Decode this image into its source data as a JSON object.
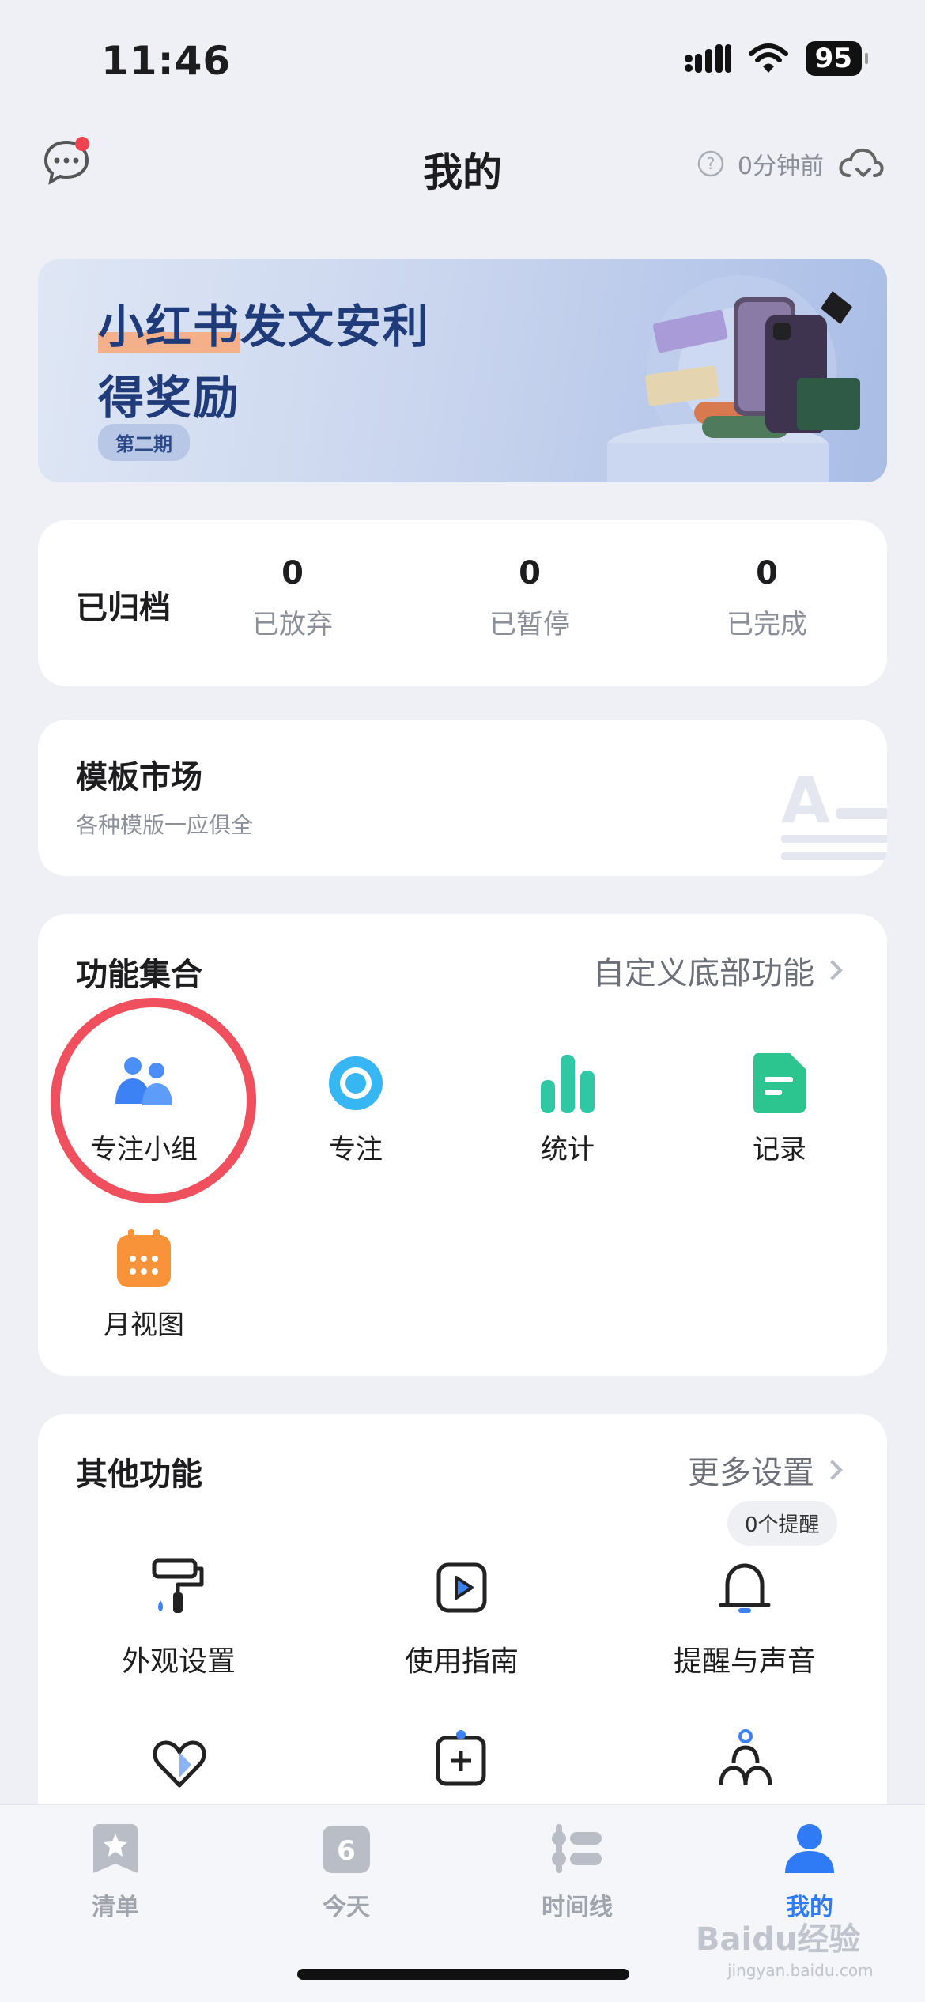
{
  "status_bar": {
    "time": "11:46",
    "battery": "95"
  },
  "header": {
    "title": "我的",
    "sync_time": "0分钟前"
  },
  "banner": {
    "line1_highlight": "小红书",
    "line1_rest": "发文安利",
    "line2": "得奖励",
    "badge": "第二期"
  },
  "archive": {
    "label": "已归档",
    "stats": [
      {
        "value": "0",
        "label": "已放弃"
      },
      {
        "value": "0",
        "label": "已暂停"
      },
      {
        "value": "0",
        "label": "已完成"
      }
    ]
  },
  "templates": {
    "title": "模板市场",
    "subtitle": "各种模版一应俱全"
  },
  "functions": {
    "title": "功能集合",
    "link": "自定义底部功能",
    "items": [
      {
        "label": "专注小组",
        "icon": "group-icon"
      },
      {
        "label": "专注",
        "icon": "focus-icon"
      },
      {
        "label": "统计",
        "icon": "stats-icon"
      },
      {
        "label": "记录",
        "icon": "record-icon"
      },
      {
        "label": "月视图",
        "icon": "calendar-icon"
      }
    ]
  },
  "other": {
    "title": "其他功能",
    "link": "更多设置",
    "remind_badge": "0个提醒",
    "items": [
      {
        "label": "外观设置",
        "icon": "paint-roller-icon"
      },
      {
        "label": "使用指南",
        "icon": "play-guide-icon"
      },
      {
        "label": "提醒与声音",
        "icon": "bell-icon"
      }
    ]
  },
  "tabbar": {
    "tabs": [
      {
        "label": "清单",
        "icon": "star-list-icon"
      },
      {
        "label": "今天",
        "icon": "today-icon",
        "day": "6"
      },
      {
        "label": "时间线",
        "icon": "timeline-icon"
      },
      {
        "label": "我的",
        "icon": "person-icon",
        "active": true
      }
    ]
  },
  "watermark": {
    "text": "Baidu经验",
    "sub": "jingyan.baidu.com"
  },
  "colors": {
    "accent": "#2f7af5",
    "highlight_circle": "#f0505e"
  }
}
